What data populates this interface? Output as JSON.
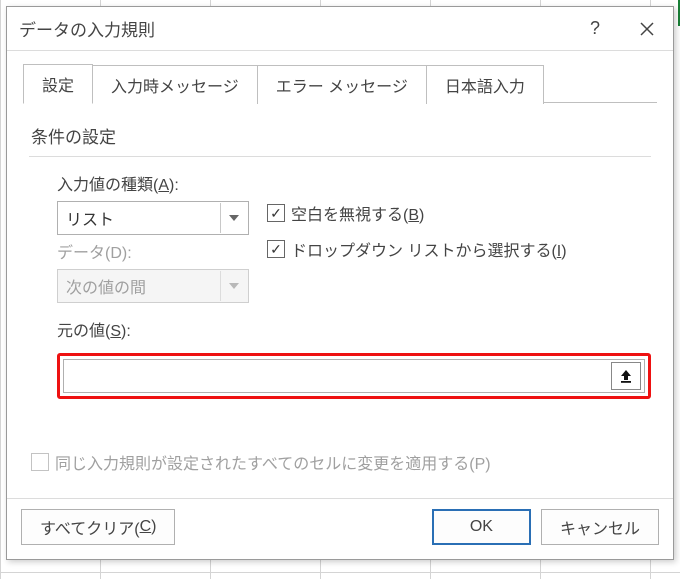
{
  "dialog": {
    "title": "データの入力規則",
    "help_tooltip": "?",
    "close_tooltip": "×"
  },
  "tabs": [
    {
      "label": "設定",
      "active": true
    },
    {
      "label": "入力時メッセージ",
      "active": false
    },
    {
      "label": "エラー メッセージ",
      "active": false
    },
    {
      "label": "日本語入力",
      "active": false
    }
  ],
  "section": {
    "title": "条件の設定"
  },
  "fields": {
    "allow_label_pre": "入力値の種類(",
    "allow_key": "A",
    "allow_label_post": "):",
    "allow_value": "リスト",
    "data_label_pre": "データ(D):",
    "data_value": "次の値の間",
    "source_label_pre": "元の値(",
    "source_key": "S",
    "source_label_post": "):",
    "source_value": ""
  },
  "checks": {
    "ignore_blank_pre": "空白を無視する(",
    "ignore_blank_key": "B",
    "ignore_blank_post": ")",
    "ignore_blank_checked": true,
    "dropdown_pre": "ドロップダウン リストから選択する(",
    "dropdown_key": "I",
    "dropdown_post": ")",
    "dropdown_checked": true,
    "apply_all_pre": "同じ入力規則が設定されたすべてのセルに変更を適用する(P)",
    "apply_all_checked": false
  },
  "buttons": {
    "clear_pre": "すべてクリア(",
    "clear_key": "C",
    "clear_post": ")",
    "ok": "OK",
    "cancel": "キャンセル"
  }
}
